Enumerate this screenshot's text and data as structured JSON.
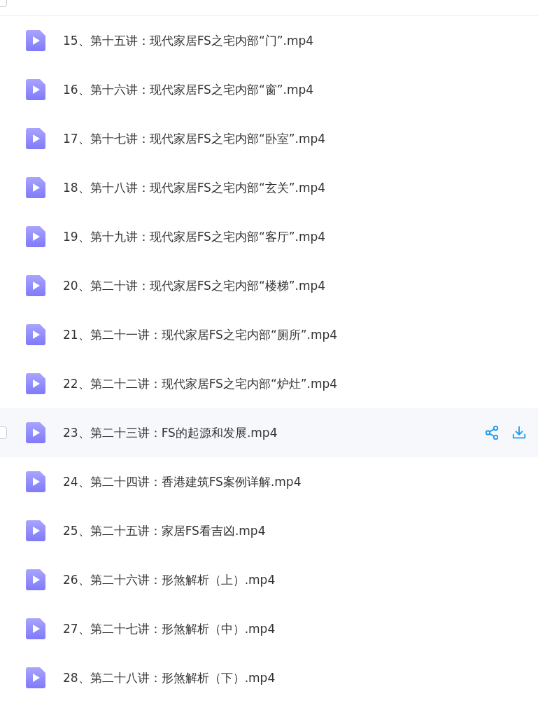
{
  "header": {
    "select_all_checked": false
  },
  "files": [
    {
      "name": "15、第十五讲：现代家居FS之宅内部“门”.mp4",
      "hovered": false
    },
    {
      "name": "16、第十六讲：现代家居FS之宅内部“窗”.mp4",
      "hovered": false
    },
    {
      "name": "17、第十七讲：现代家居FS之宅内部“卧室”.mp4",
      "hovered": false
    },
    {
      "name": "18、第十八讲：现代家居FS之宅内部“玄关”.mp4",
      "hovered": false
    },
    {
      "name": "19、第十九讲：现代家居FS之宅内部“客厅”.mp4",
      "hovered": false
    },
    {
      "name": "20、第二十讲：现代家居FS之宅内部“楼梯”.mp4",
      "hovered": false
    },
    {
      "name": "21、第二十一讲：现代家居FS之宅内部“厕所”.mp4",
      "hovered": false
    },
    {
      "name": "22、第二十二讲：现代家居FS之宅内部“炉灶”.mp4",
      "hovered": false
    },
    {
      "name": "23、第二十三讲：FS的起源和发展.mp4",
      "hovered": true
    },
    {
      "name": "24、第二十四讲：香港建筑FS案例详解.mp4",
      "hovered": false
    },
    {
      "name": "25、第二十五讲：家居FS看吉凶.mp4",
      "hovered": false
    },
    {
      "name": "26、第二十六讲：形煞解析（上）.mp4",
      "hovered": false
    },
    {
      "name": "27、第二十七讲：形煞解析（中）.mp4",
      "hovered": false
    },
    {
      "name": "28、第二十八讲：形煞解析（下）.mp4",
      "hovered": false
    }
  ]
}
